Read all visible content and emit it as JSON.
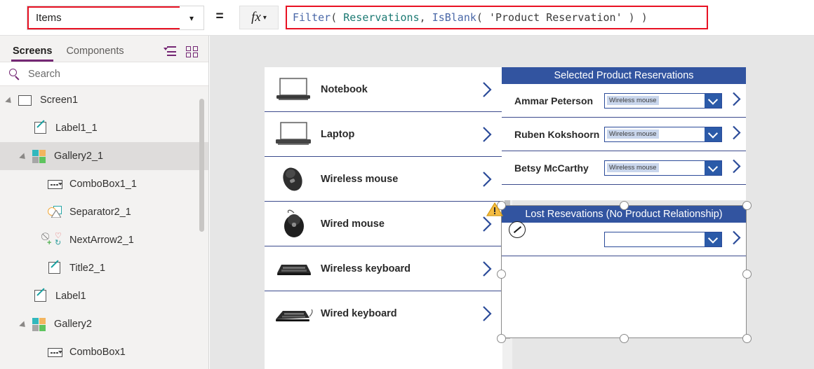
{
  "topbar": {
    "property_value": "Items",
    "property_caret_icon": "chevron-down-icon",
    "equals_sign": "=",
    "fx_label": "fx",
    "fx_caret_icon": "chevron-down-icon",
    "formula_tokens": [
      {
        "text": "Filter",
        "kind": "fn"
      },
      {
        "text": "( ",
        "kind": "punct"
      },
      {
        "text": "Reservations",
        "kind": "tbl"
      },
      {
        "text": ", ",
        "kind": "punct"
      },
      {
        "text": "IsBlank",
        "kind": "fn"
      },
      {
        "text": "( ",
        "kind": "punct"
      },
      {
        "text": "'Product Reservation'",
        "kind": "str"
      },
      {
        "text": " ) )",
        "kind": "punct"
      }
    ],
    "formula_plain": "Filter( Reservations, IsBlank( 'Product Reservation' ) )"
  },
  "sidebar": {
    "tabs": [
      {
        "label": "Screens",
        "active": true
      },
      {
        "label": "Components",
        "active": false
      }
    ],
    "toolbar_icons": [
      "list-view-icon",
      "grid-view-icon"
    ],
    "search": {
      "placeholder": "Search",
      "value": "",
      "icon": "search-icon"
    },
    "tree": [
      {
        "label": "Screen1",
        "indent": 0,
        "icon": "screen-icon",
        "twisty": true,
        "selected": false
      },
      {
        "label": "Label1_1",
        "indent": 1,
        "icon": "label-icon",
        "twisty": false,
        "selected": false
      },
      {
        "label": "Gallery2_1",
        "indent": 1,
        "icon": "gallery-icon",
        "twisty": true,
        "selected": true
      },
      {
        "label": "ComboBox1_1",
        "indent": 2,
        "icon": "combobox-icon",
        "twisty": false,
        "selected": false
      },
      {
        "label": "Separator2_1",
        "indent": 2,
        "icon": "separator-icon",
        "twisty": false,
        "selected": false
      },
      {
        "label": "NextArrow2_1",
        "indent": 2,
        "icon": "nextarrow-icon",
        "twisty": false,
        "selected": false
      },
      {
        "label": "Title2_1",
        "indent": 2,
        "icon": "label-icon",
        "twisty": false,
        "selected": false
      },
      {
        "label": "Label1",
        "indent": 1,
        "icon": "label-icon",
        "twisty": false,
        "selected": false
      },
      {
        "label": "Gallery2",
        "indent": 1,
        "icon": "gallery-icon",
        "twisty": true,
        "selected": false
      },
      {
        "label": "ComboBox1",
        "indent": 2,
        "icon": "combobox-icon",
        "twisty": false,
        "selected": false
      }
    ]
  },
  "canvas": {
    "product_gallery": {
      "name": "product-list-gallery",
      "items": [
        {
          "name": "Notebook",
          "image": "notebook-image",
          "chevron": "chevron-right-icon"
        },
        {
          "name": "Laptop",
          "image": "laptop-image",
          "chevron": "chevron-right-icon"
        },
        {
          "name": "Wireless mouse",
          "image": "wireless-mouse-image",
          "chevron": "chevron-right-icon"
        },
        {
          "name": "Wired mouse",
          "image": "wired-mouse-image",
          "chevron": "chevron-right-icon"
        },
        {
          "name": "Wireless keyboard",
          "image": "wireless-keyboard-image",
          "chevron": "chevron-right-icon"
        },
        {
          "name": "Wired keyboard",
          "image": "wired-keyboard-image",
          "chevron": "chevron-right-icon"
        }
      ]
    },
    "selected_reservations": {
      "title": "Selected Product Reservations",
      "rows": [
        {
          "person": "Ammar Peterson",
          "combo_value": "Wireless mouse",
          "chevron": "chevron-right-icon"
        },
        {
          "person": "Ruben Kokshoorn",
          "combo_value": "Wireless mouse",
          "chevron": "chevron-right-icon"
        },
        {
          "person": "Betsy McCarthy",
          "combo_value": "Wireless mouse",
          "chevron": "chevron-right-icon"
        }
      ]
    },
    "lost_reservations": {
      "title": "Lost Resevations (No Product Relationship)",
      "rows": [
        {
          "person": "",
          "combo_value": "",
          "chevron": "chevron-right-icon"
        }
      ],
      "selected": true,
      "warning_icon": "warning-triangle-icon",
      "edit_badge_icon": "pencil-circle-icon"
    }
  },
  "colors": {
    "accent_purple": "#742774",
    "header_blue": "#3254a0",
    "chevron_blue": "#2b4b99",
    "error_red": "#e81123",
    "warning_yellow": "#f5bc42",
    "chip_blue": "#c9d6ec"
  }
}
